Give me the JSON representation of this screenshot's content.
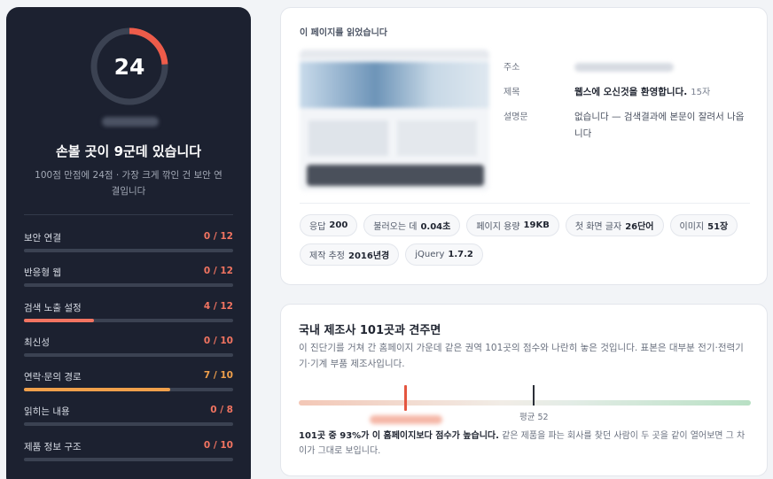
{
  "score": {
    "value": "24",
    "max": 100,
    "accent": "#ee5c4a",
    "track": "#3b4252"
  },
  "left": {
    "headline": "손볼 곳이 9군데 있습니다",
    "subtitle": "100점 만점에 24점 · 가장 크게 깎인 건 보안 연결입니다",
    "metrics": [
      {
        "label": "보안 연결",
        "value": "0 / 12",
        "fraction": 0.0,
        "color": "#f27461"
      },
      {
        "label": "반응형 웹",
        "value": "0 / 12",
        "fraction": 0.0,
        "color": "#f27461"
      },
      {
        "label": "검색 노출 설정",
        "value": "4 / 12",
        "fraction": 0.333,
        "color": "#f27461"
      },
      {
        "label": "최신성",
        "value": "0 / 10",
        "fraction": 0.0,
        "color": "#f27461"
      },
      {
        "label": "연락·문의 경로",
        "value": "7 / 10",
        "fraction": 0.7,
        "color": "#f0a04b"
      },
      {
        "label": "읽히는 내용",
        "value": "0 / 8",
        "fraction": 0.0,
        "color": "#f27461"
      },
      {
        "label": "제품 정보 구조",
        "value": "0 / 10",
        "fraction": 0.0,
        "color": "#f27461"
      }
    ]
  },
  "page_card": {
    "heading": "이 페이지를 읽었습니다",
    "fields": {
      "address_label": "주소",
      "title_label": "제목",
      "title_value": "웹스에 오신것을 환영합니다.",
      "title_count": "15자",
      "desc_label": "설명문",
      "desc_value": "없습니다 — 검색결과에 본문이 잘려서 나옵니다"
    },
    "chips": [
      {
        "key": "응답",
        "value": "200"
      },
      {
        "key": "불러오는 데",
        "value": "0.04초"
      },
      {
        "key": "페이지 용량",
        "value": "19KB"
      },
      {
        "key": "첫 화면 글자",
        "value": "26단어"
      },
      {
        "key": "이미지",
        "value": "51장"
      },
      {
        "key": "제작 추정",
        "value": "2016년경"
      },
      {
        "key": "jQuery",
        "value": "1.7.2"
      }
    ]
  },
  "compare_card": {
    "title": "국내 제조사 101곳과 견주면",
    "description": "이 진단기를 거쳐 간 홈페이지 가운데 같은 권역 101곳의 점수와 나란히 놓은 것입니다. 표본은 대부분 전기·전력기기·기계 부품 제조사입니다.",
    "avg_label": "평균 52",
    "footer_bold": "101곳 중 93%가 이 홈페이지보다 점수가 높습니다.",
    "footer_rest": " 같은 제품을 파는 회사를 찾던 사람이 두 곳을 같이 열어보면 그 차이가 그대로 보입니다."
  }
}
